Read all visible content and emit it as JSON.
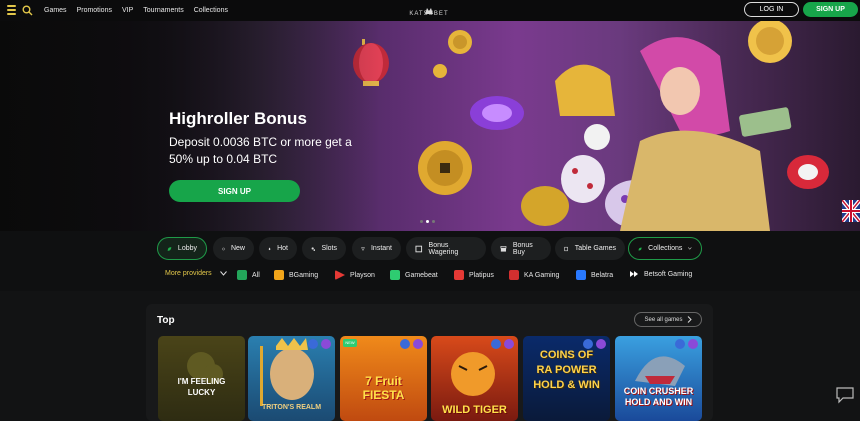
{
  "header": {
    "nav": [
      "Games",
      "Promotions",
      "VIP",
      "Tournaments",
      "Collections"
    ],
    "logo_text": "KATSUBET",
    "login_label": "LOG IN",
    "signup_label": "SIGN UP"
  },
  "hero": {
    "title": "Highroller Bonus",
    "subtitle": "Deposit 0.0036 BTC or more get a 50% up to 0.04 BTC",
    "button_label": "SIGN UP",
    "slides": 3,
    "active_slide": 2
  },
  "categories": [
    {
      "label": "Lobby",
      "icon": "lobby-icon"
    },
    {
      "label": "New",
      "icon": "new-icon"
    },
    {
      "label": "Hot",
      "icon": "fire-icon"
    },
    {
      "label": "Slots",
      "icon": "slots-icon"
    },
    {
      "label": "Instant",
      "icon": "instant-icon"
    },
    {
      "label": "Bonus Wagering",
      "icon": "bonus-wagering-icon"
    },
    {
      "label": "Bonus Buy",
      "icon": "bonus-buy-icon"
    },
    {
      "label": "Table Games",
      "icon": "table-games-icon"
    }
  ],
  "collections_label": "Collections",
  "providers": {
    "more_label": "More providers",
    "items": [
      {
        "label": "All",
        "color": "#23a55a"
      },
      {
        "label": "BGaming",
        "color": "#f2a51a"
      },
      {
        "label": "Playson",
        "color": "#e53935"
      },
      {
        "label": "Gamebeat",
        "color": "#2ecc71"
      },
      {
        "label": "Platipus",
        "color": "#e53935"
      },
      {
        "label": "KA Gaming",
        "color": "#d32f2f"
      },
      {
        "label": "Belatra",
        "color": "#2979ff"
      },
      {
        "label": "Betsoft Gaming",
        "color": "#ffffff"
      }
    ]
  },
  "top": {
    "title": "Top",
    "see_all_label": "See all games",
    "games": [
      {
        "name": "I'M FEELING LUCKY"
      },
      {
        "name": "TRITON'S REALM"
      },
      {
        "name": "7 Fruit FIESTA",
        "badge": "NEW"
      },
      {
        "name": "WILD TIGER"
      },
      {
        "name": "COINS OF RA POWER HOLD & WIN"
      },
      {
        "name": "COIN CRUSHER HOLD AND WIN"
      }
    ]
  },
  "colors": {
    "accent": "#17a54a",
    "gold": "#e2c74a",
    "background": "#121314"
  }
}
